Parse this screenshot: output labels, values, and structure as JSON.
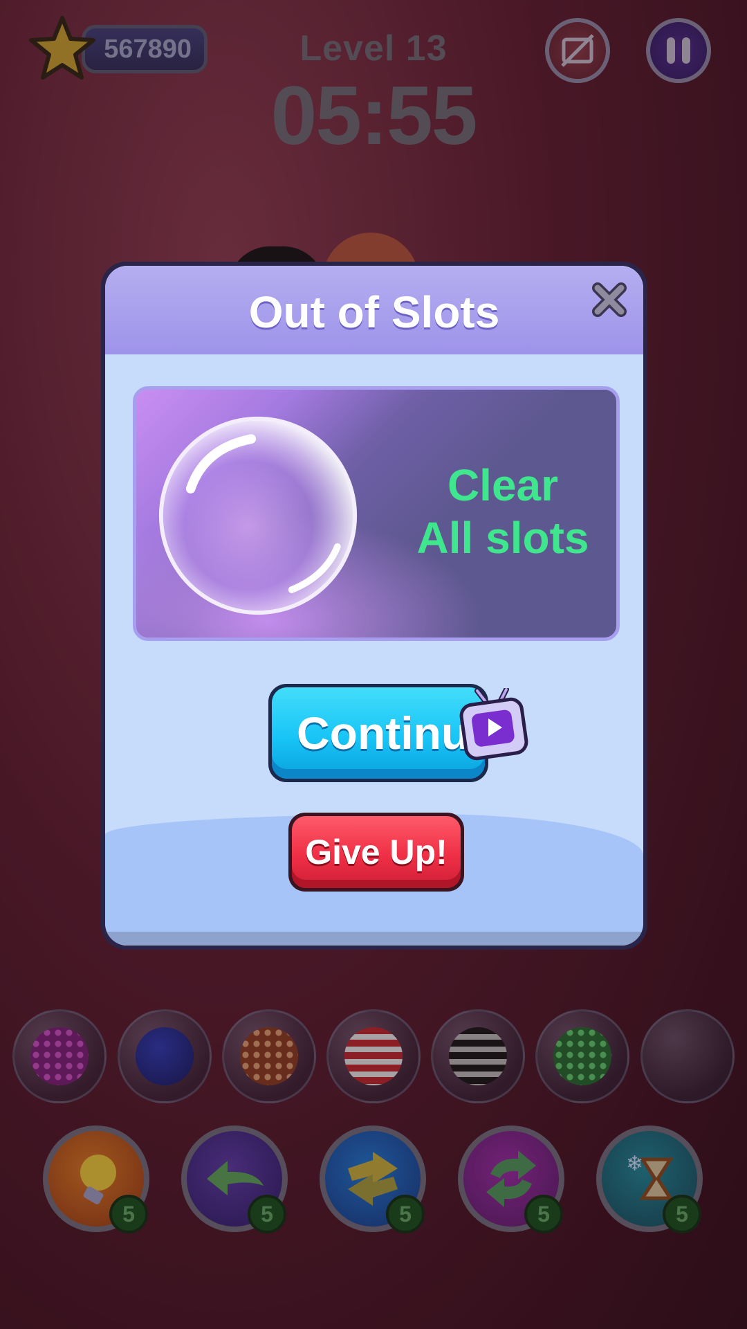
{
  "hud": {
    "score": "567890",
    "level": "Level 13",
    "timer": "05:55"
  },
  "dialog": {
    "title": "Out of Slots",
    "promo_line1": "Clear",
    "promo_line2": "All slots",
    "continue_label": "Continue",
    "give_up_label": "Give Up!"
  },
  "slots": [
    "pink-dotted-ball",
    "blue-ball",
    "orange-dotted-ball",
    "red-striped-ball",
    "black-striped-ball",
    "green-dotted-ball",
    "empty"
  ],
  "powerups": [
    {
      "name": "hint-bulb",
      "count": "5"
    },
    {
      "name": "undo-arrow",
      "count": "5"
    },
    {
      "name": "shuffle-arrows",
      "count": "5"
    },
    {
      "name": "swap-arrows",
      "count": "5"
    },
    {
      "name": "freeze-timer",
      "count": "5"
    }
  ],
  "colors": {
    "accent_cyan": "#18c5f6",
    "danger_red": "#ef2f45",
    "promo_green": "#3fe68e",
    "dialog_header": "#9e93ea"
  }
}
